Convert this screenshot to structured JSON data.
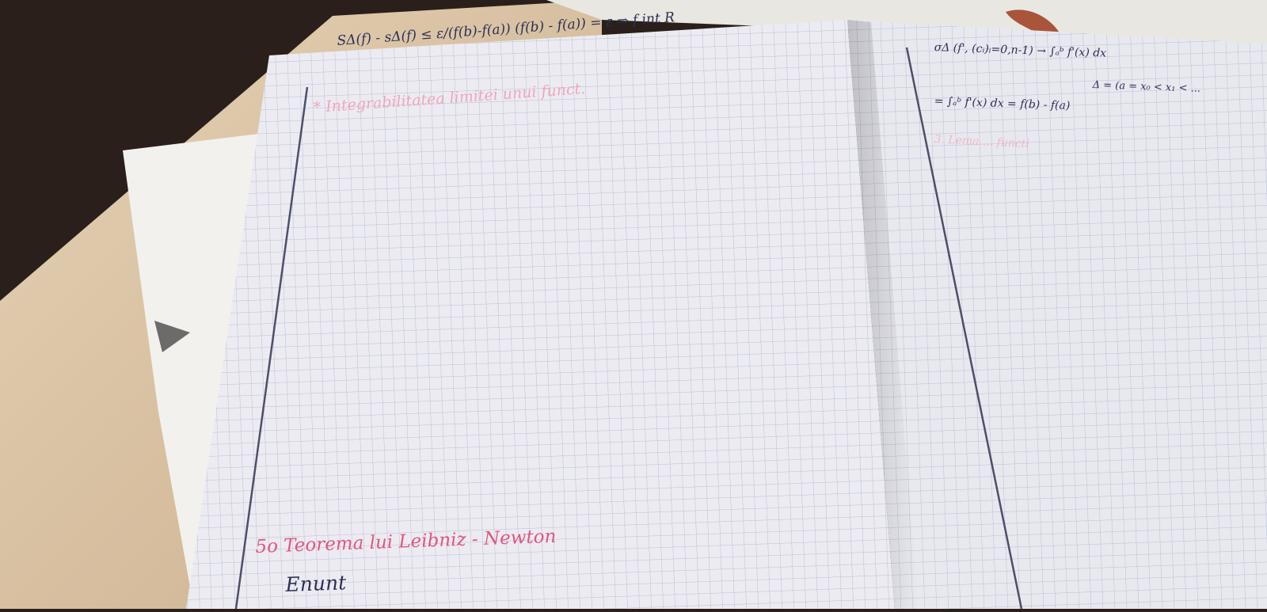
{
  "colors": {
    "paper": "#ecebf2",
    "grid": "#b9bfd4",
    "ink_dark": "#2b2f55",
    "ink_pink": "#e2567d",
    "desk": "#d9c2a4",
    "background": "#2a1f1a"
  },
  "left_page": {
    "formula_line": "SΔ(f) - sΔ(f) ≤ ε/(f(b)-f(a)) (f(b) - f(a)) = ε ⇒ f int R",
    "pink_heading": "* Integrabilitatea limitei unui funct.",
    "section_title": "5o Teorema lui Leibniz - Newton",
    "enunt": "Enunt"
  },
  "right_page": {
    "line1": "σΔ (f', (cᵢ)ᵢ=0,n-1) → ∫ₐᵇ f'(x) dx",
    "line2": "Δ = (a = x₀ < x₁ < ...",
    "line3": "= ∫ₐᵇ f'(x) dx = f(b) - f(a)",
    "faint_heading": "3. Lema ... functi"
  }
}
